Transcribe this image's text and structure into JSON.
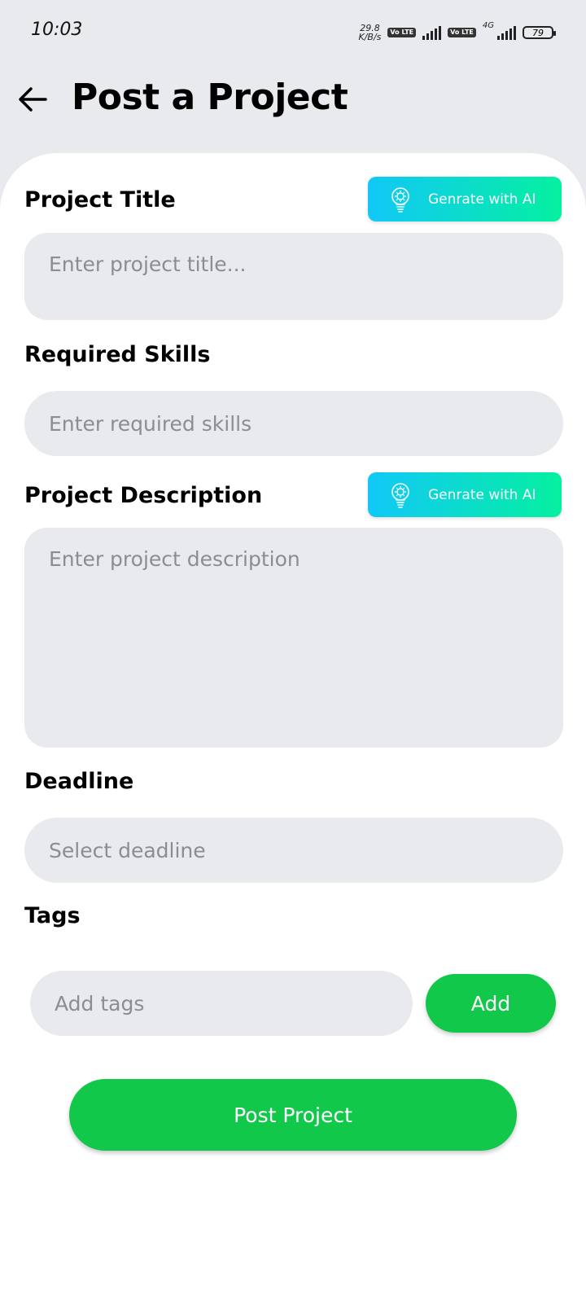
{
  "status_bar": {
    "time": "10:03",
    "speed_value": "29.8",
    "speed_unit": "K/B/s",
    "volte_1": "Vo LTE",
    "volte_2": "Vo LTE",
    "network": "4G",
    "battery": "79"
  },
  "header": {
    "title": "Post a Project"
  },
  "form": {
    "project_title": {
      "label": "Project Title",
      "ai_button": "Genrate with AI",
      "placeholder": "Enter project title..."
    },
    "required_skills": {
      "label": "Required Skills",
      "placeholder": "Enter required skills"
    },
    "project_description": {
      "label": "Project Description",
      "ai_button": "Genrate with AI",
      "placeholder": "Enter project description"
    },
    "deadline": {
      "label": "Deadline",
      "placeholder": "Select deadline"
    },
    "tags": {
      "label": "Tags",
      "placeholder": "Add tags",
      "add_button": "Add"
    },
    "submit_button": "Post Project"
  },
  "colors": {
    "accent_green": "#12c84a",
    "ai_gradient_start": "#11c8f7",
    "ai_gradient_end": "#05f0a0",
    "field_background": "#e8eaed"
  }
}
